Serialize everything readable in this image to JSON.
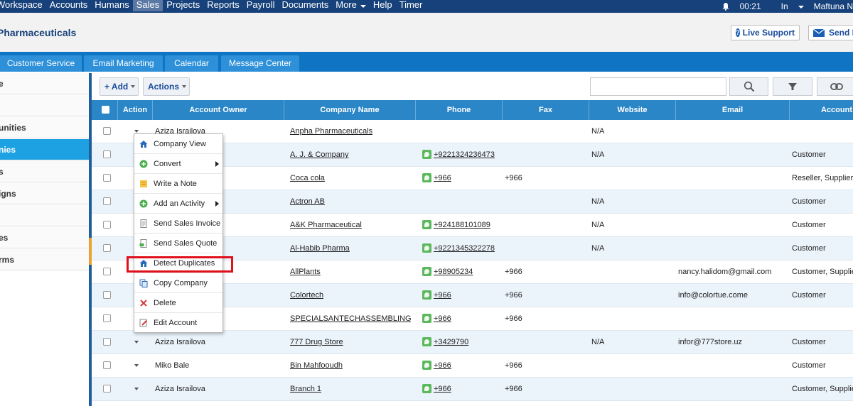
{
  "topnav": {
    "items": [
      "Workspace",
      "Accounts",
      "Humans",
      "Sales",
      "Projects",
      "Reports",
      "Payroll",
      "Documents",
      "More",
      "Help",
      "Timer"
    ],
    "active": "Sales",
    "time": "00:21",
    "login_label": "In",
    "user_name": "Maftuna N"
  },
  "header": {
    "title": "Pharmaceuticals",
    "live_support": "Live Support",
    "send": "Send F"
  },
  "tabs": [
    "Customer Service",
    "Email Marketing",
    "Calendar",
    "Message Center"
  ],
  "sidebar": {
    "items": [
      "e",
      "",
      "unities",
      "nies",
      "s",
      "igns",
      "",
      "es",
      "rms"
    ],
    "active_index": 3
  },
  "toolbar": {
    "add": "+ Add",
    "actions": "Actions"
  },
  "table": {
    "headers": [
      "Action",
      "Account Owner",
      "Company Name",
      "Phone",
      "Fax",
      "Website",
      "Email",
      "Account"
    ],
    "rows": [
      {
        "owner": "Aziza Israilova",
        "company": "Anpha Pharmaceuticals",
        "phone": "",
        "fax": "",
        "website": "N/A",
        "email": "",
        "type": ""
      },
      {
        "owner": "",
        "company": "A. J. & Company",
        "phone": "+9221324236473",
        "fax": "",
        "website": "N/A",
        "email": "",
        "type": "Customer"
      },
      {
        "owner": "",
        "company": "Coca cola",
        "phone": "+966",
        "fax": "+966",
        "website": "",
        "email": "",
        "type": "Reseller, Supplier"
      },
      {
        "owner": "",
        "company": "Actron AB",
        "phone": "",
        "fax": "",
        "website": "N/A",
        "email": "",
        "type": "Customer"
      },
      {
        "owner": "",
        "company": "A&K Pharmaceutical",
        "phone": "+924188101089",
        "fax": "",
        "website": "N/A",
        "email": "",
        "type": "Customer"
      },
      {
        "owner": "",
        "company": "Al-Habib Pharma",
        "phone": "+9221345322278",
        "fax": "",
        "website": "N/A",
        "email": "",
        "type": "Customer"
      },
      {
        "owner": "",
        "company": "AllPlants",
        "phone": "+98905234",
        "fax": "+966",
        "website": "",
        "email": "nancy.halidom@gmail.com",
        "type": "Customer, Supplie"
      },
      {
        "owner": "",
        "company": "Colortech",
        "phone": "+966",
        "fax": "+966",
        "website": "",
        "email": "info@colortue.come",
        "type": "Customer"
      },
      {
        "owner": "",
        "company": "SPECIALSANTECHASSEMBLING",
        "phone": "+966",
        "fax": "+966",
        "website": "",
        "email": "",
        "type": ""
      },
      {
        "owner": "Aziza Israilova",
        "company": "777 Drug Store",
        "phone": "+3429790",
        "fax": "",
        "website": "N/A",
        "email": "infor@777store.uz",
        "type": "Customer"
      },
      {
        "owner": "Miko Bale",
        "company": "Bin Mahfooudh",
        "phone": "+966",
        "fax": "+966",
        "website": "",
        "email": "",
        "type": "Customer"
      },
      {
        "owner": "Aziza Israilova",
        "company": "Branch 1",
        "phone": "+966",
        "fax": "+966",
        "website": "",
        "email": "",
        "type": "Customer, Supplie"
      }
    ]
  },
  "context_menu": {
    "items": [
      "Company View",
      "Convert",
      "Write a Note",
      "Add an Activity",
      "Send Sales Invoice",
      "Send Sales Quote",
      "Detect Duplicates",
      "Copy Company",
      "Delete",
      "Edit Account"
    ],
    "highlighted": "Detect Duplicates"
  },
  "colors": {
    "nav_bg": "#16417a",
    "tab_bar": "#0f74c4",
    "header_row": "#2b86c8",
    "active_sidebar": "#1da1e3",
    "highlight": "#e0101b"
  }
}
